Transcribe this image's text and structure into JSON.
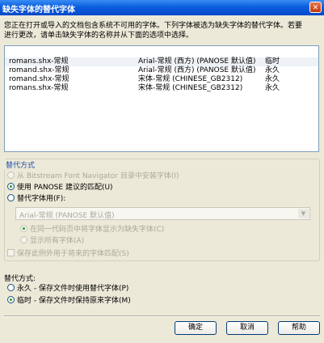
{
  "window": {
    "title": "缺失字体的替代字体",
    "close_glyph": "✕"
  },
  "description": "您正在打开或导入的文档包含系统不可用的字体。下列字体被选为缺失字体的替代字体。若要\n进行更改，请单击缺失字体的名称并从下面的选项中选择。",
  "font_table": [
    {
      "missing": "romans.shx-常规",
      "replacement": "Arial-常规 (西方) (PANOSE 默认值)",
      "type": "临时"
    },
    {
      "missing": "romand.shx-常规",
      "replacement": "Arial-常规 (西方) (PANOSE 默认值)",
      "type": "永久"
    },
    {
      "missing": "romand.shx-常规",
      "replacement": "宋体-常规 (CHINESE_GB2312)",
      "type": "永久"
    },
    {
      "missing": "romans.shx-常规",
      "replacement": "宋体-常规 (CHINESE_GB2312)",
      "type": "永久"
    }
  ],
  "substitution_group": {
    "legend": "替代方式",
    "opt_bitstream": "从 Bitstream Font Navigator 目录中安装字体(I)",
    "opt_panose": "使用 PANOSE 建议的匹配(U)",
    "opt_use_font": "替代字体用(F):",
    "font_combo_value": "Arial-常规 (PANOSE 默认值)",
    "opt_show_in_page": "在同一代码页中将字体显示为缺失字体(C)",
    "opt_show_all": "显示所有字体(A)",
    "chk_save_exception": "保存此例外用于将来的字体匹配(S)"
  },
  "replace_mode": {
    "label": "替代方式:",
    "opt_permanent": "永久 - 保存文件时使用替代字体(P)",
    "opt_temporary": "临时 - 保存文件时保持原来字体(M)"
  },
  "buttons": {
    "ok": "确定",
    "cancel": "取消",
    "help": "帮助"
  },
  "colors": {
    "title_bar": "#0a5fe0",
    "dialog_bg": "#ece9d8",
    "legend_text": "#1f4ea8"
  }
}
